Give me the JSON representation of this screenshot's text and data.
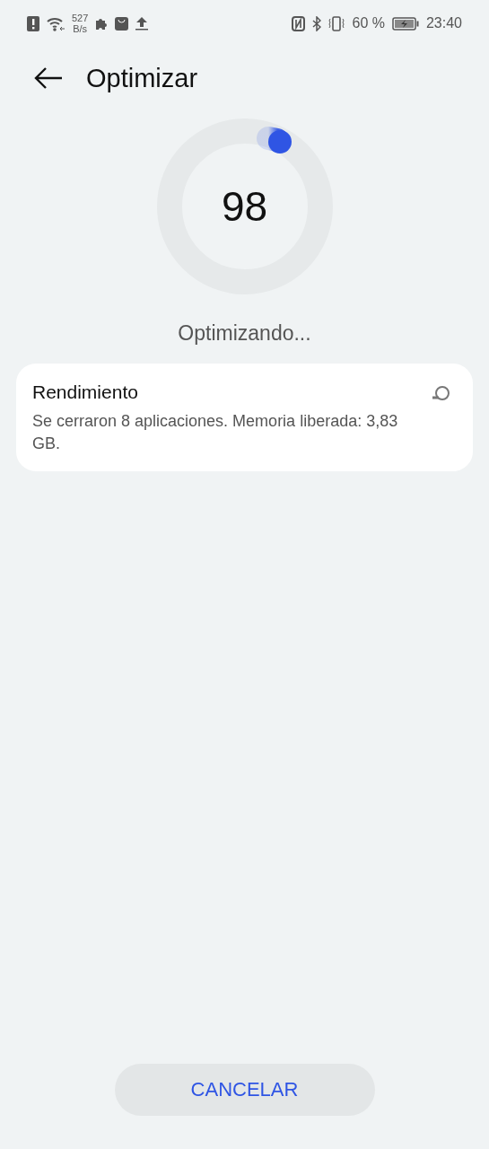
{
  "status_bar": {
    "net_speed_value": "527",
    "net_speed_unit": "B/s",
    "battery_percent": "60 %",
    "time": "23:40"
  },
  "header": {
    "title": "Optimizar"
  },
  "progress": {
    "score": "98",
    "status": "Optimizando..."
  },
  "results": [
    {
      "title": "Rendimiento",
      "description": "Se cerraron 8 aplicaciones. Memoria liberada: 3,83 GB."
    }
  ],
  "buttons": [
    {
      "label": "CANCELAR"
    }
  ]
}
